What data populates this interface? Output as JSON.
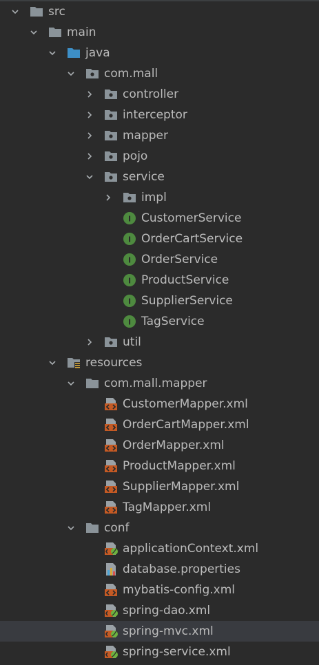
{
  "colors": {
    "background": "#2b2b2b",
    "text": "#bbbbbb",
    "folder": "#8a9399",
    "source_folder": "#3d8fc7",
    "interface_badge": "#4e8a3f",
    "xml_icon": "#c55a24",
    "selected_row": "#393b40"
  },
  "tree": [
    {
      "depth": 0,
      "arrow": "down",
      "icon": "folder-icon",
      "label": "src"
    },
    {
      "depth": 1,
      "arrow": "down",
      "icon": "folder-icon",
      "label": "main"
    },
    {
      "depth": 2,
      "arrow": "down",
      "icon": "source-folder-icon",
      "label": "java"
    },
    {
      "depth": 3,
      "arrow": "down",
      "icon": "package-icon",
      "label": "com.mall"
    },
    {
      "depth": 4,
      "arrow": "right",
      "icon": "package-icon",
      "label": "controller"
    },
    {
      "depth": 4,
      "arrow": "right",
      "icon": "package-icon",
      "label": "interceptor"
    },
    {
      "depth": 4,
      "arrow": "right",
      "icon": "package-icon",
      "label": "mapper"
    },
    {
      "depth": 4,
      "arrow": "right",
      "icon": "package-icon",
      "label": "pojo"
    },
    {
      "depth": 4,
      "arrow": "down",
      "icon": "package-icon",
      "label": "service"
    },
    {
      "depth": 5,
      "arrow": "right",
      "icon": "package-icon",
      "label": "impl"
    },
    {
      "depth": 5,
      "arrow": "none",
      "icon": "interface-icon",
      "label": "CustomerService"
    },
    {
      "depth": 5,
      "arrow": "none",
      "icon": "interface-icon",
      "label": "OrderCartService"
    },
    {
      "depth": 5,
      "arrow": "none",
      "icon": "interface-icon",
      "label": "OrderService"
    },
    {
      "depth": 5,
      "arrow": "none",
      "icon": "interface-icon",
      "label": "ProductService"
    },
    {
      "depth": 5,
      "arrow": "none",
      "icon": "interface-icon",
      "label": "SupplierService"
    },
    {
      "depth": 5,
      "arrow": "none",
      "icon": "interface-icon",
      "label": "TagService"
    },
    {
      "depth": 4,
      "arrow": "right",
      "icon": "package-icon",
      "label": "util"
    },
    {
      "depth": 2,
      "arrow": "down",
      "icon": "resources-folder-icon",
      "label": "resources"
    },
    {
      "depth": 3,
      "arrow": "down",
      "icon": "folder-icon",
      "label": "com.mall.mapper"
    },
    {
      "depth": 4,
      "arrow": "none",
      "icon": "xml-file-icon",
      "label": "CustomerMapper.xml"
    },
    {
      "depth": 4,
      "arrow": "none",
      "icon": "xml-file-icon",
      "label": "OrderCartMapper.xml"
    },
    {
      "depth": 4,
      "arrow": "none",
      "icon": "xml-file-icon",
      "label": "OrderMapper.xml"
    },
    {
      "depth": 4,
      "arrow": "none",
      "icon": "xml-file-icon",
      "label": "ProductMapper.xml"
    },
    {
      "depth": 4,
      "arrow": "none",
      "icon": "xml-file-icon",
      "label": "SupplierMapper.xml"
    },
    {
      "depth": 4,
      "arrow": "none",
      "icon": "xml-file-icon",
      "label": "TagMapper.xml"
    },
    {
      "depth": 3,
      "arrow": "down",
      "icon": "folder-icon",
      "label": "conf"
    },
    {
      "depth": 4,
      "arrow": "none",
      "icon": "spring-xml-icon",
      "label": "applicationContext.xml"
    },
    {
      "depth": 4,
      "arrow": "none",
      "icon": "properties-file-icon",
      "label": "database.properties"
    },
    {
      "depth": 4,
      "arrow": "none",
      "icon": "xml-file-icon",
      "label": "mybatis-config.xml"
    },
    {
      "depth": 4,
      "arrow": "none",
      "icon": "spring-xml-icon",
      "label": "spring-dao.xml"
    },
    {
      "depth": 4,
      "arrow": "none",
      "icon": "spring-xml-icon",
      "label": "spring-mvc.xml",
      "selected": true
    },
    {
      "depth": 4,
      "arrow": "none",
      "icon": "spring-xml-icon",
      "label": "spring-service.xml"
    }
  ]
}
